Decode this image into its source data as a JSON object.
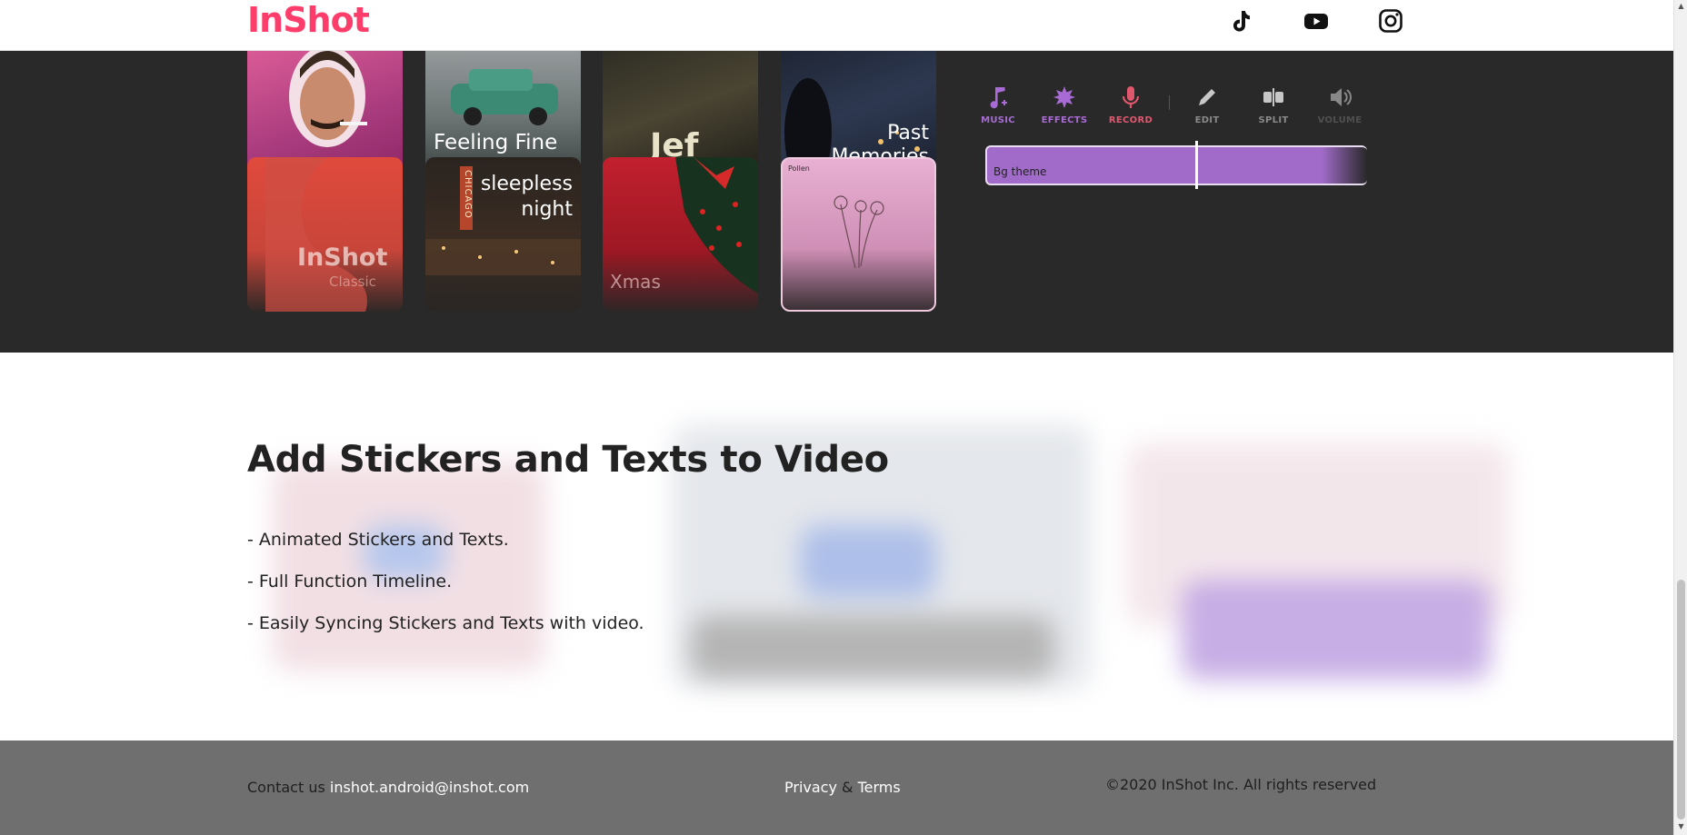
{
  "header": {
    "logo_text": "InShot",
    "social": [
      {
        "name": "tiktok-icon"
      },
      {
        "name": "youtube-icon"
      },
      {
        "name": "instagram-icon"
      }
    ]
  },
  "themes": {
    "row1": [
      {
        "label": ""
      },
      {
        "label": "Feeling Fine"
      },
      {
        "label": "Jef"
      },
      {
        "label_line1": "Past",
        "label_line2": "Memories"
      }
    ],
    "row2": [
      {
        "label": "InShot",
        "sub": "Classic"
      },
      {
        "label_line1": "sleepless",
        "label_line2": "night",
        "sign": "CHICAGO"
      },
      {
        "label": "Xmas"
      },
      {
        "label": "Pollen"
      }
    ]
  },
  "editor": {
    "tools": [
      {
        "label": "MUSIC",
        "color": "#a86bd6"
      },
      {
        "label": "EFFECTS",
        "color": "#a86bd6"
      },
      {
        "label": "RECORD",
        "color": "#e0576e"
      },
      {
        "label": "EDIT",
        "color": "#8a8a8a"
      },
      {
        "label": "SPLIT",
        "color": "#8a8a8a"
      },
      {
        "label": "VOLUME",
        "color": "#6a6a6a"
      }
    ],
    "timeline_label": "Bg theme"
  },
  "stickers": {
    "title": "Add Stickers and Texts to Video",
    "items": [
      "- Animated Stickers and Texts.",
      "- Full Function Timeline.",
      "- Easily Syncing Stickers and Texts with video."
    ]
  },
  "footer": {
    "contact_label": "Contact us",
    "contact_email": "inshot.android@inshot.com",
    "privacy": "Privacy",
    "amp": "&",
    "terms": "Terms",
    "copyright": "©2020 InShot Inc. All rights reserved"
  },
  "colors": {
    "brand": "#ff3d6b",
    "dark_bg": "#292929",
    "footer_bg": "#6f6f6f",
    "timeline": "#a16cc9"
  }
}
